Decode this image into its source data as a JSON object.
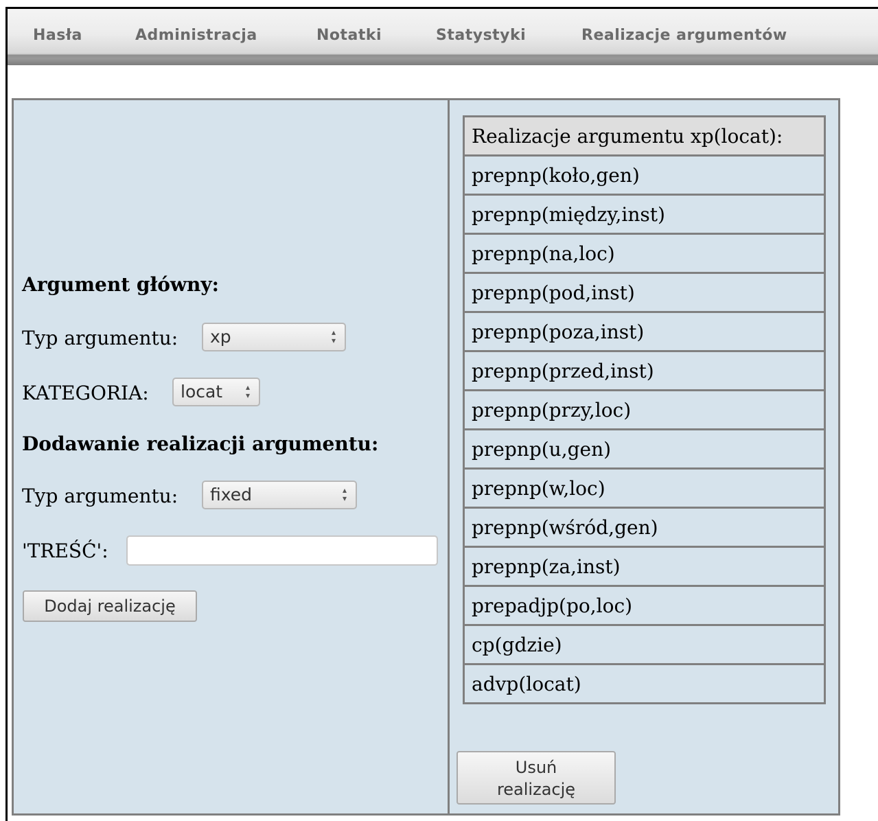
{
  "nav": {
    "items": [
      "Hasła",
      "Administracja",
      "Notatki",
      "Statystyki",
      "Realizacje argumentów"
    ]
  },
  "left": {
    "main_heading": "Argument główny:",
    "arg_type_label": "Typ argumentu:",
    "arg_type_value": "xp",
    "category_label": "KATEGORIA:",
    "category_value": "locat",
    "add_heading": "Dodawanie realizacji argumentu:",
    "add_type_label": "Typ argumentu:",
    "add_type_value": "fixed",
    "content_label": "'TREŚĆ':",
    "content_value": "",
    "add_button": "Dodaj realizację"
  },
  "right": {
    "table_header": "Realizacje argumentu xp(locat):",
    "rows": [
      "prepnp(koło,gen)",
      "prepnp(między,inst)",
      "prepnp(na,loc)",
      "prepnp(pod,inst)",
      "prepnp(poza,inst)",
      "prepnp(przed,inst)",
      "prepnp(przy,loc)",
      "prepnp(u,gen)",
      "prepnp(w,loc)",
      "prepnp(wśród,gen)",
      "prepnp(za,inst)",
      "prepadjp(po,loc)",
      "cp(gdzie)",
      "advp(locat)"
    ],
    "remove_button_line1": "Usuń",
    "remove_button_line2": "realizację"
  }
}
